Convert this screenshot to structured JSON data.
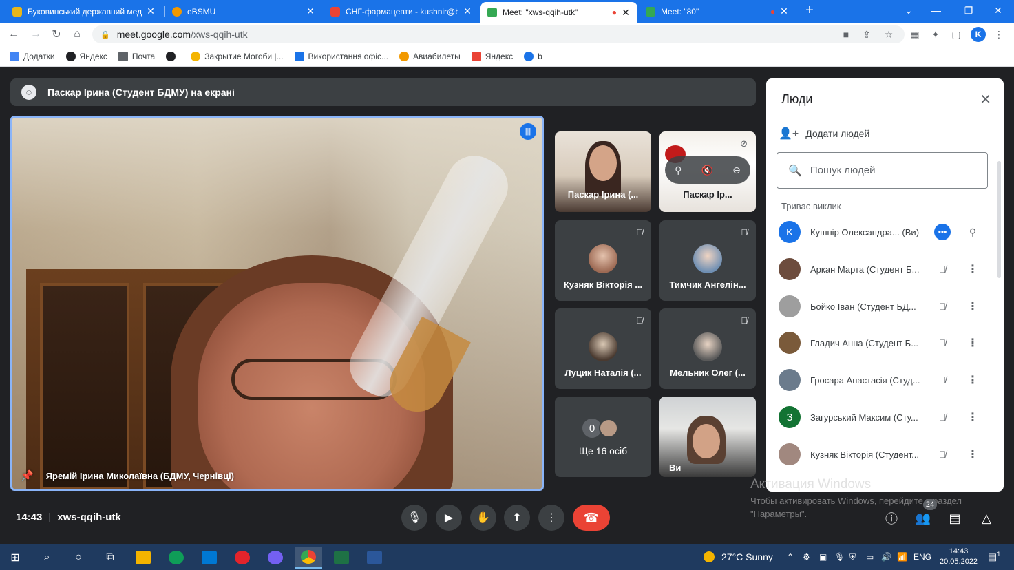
{
  "tabs": [
    {
      "title": "Буковинський державний меди",
      "favicon_color": "#e8b71a"
    },
    {
      "title": "eBSMU",
      "favicon_color": "#f29900"
    },
    {
      "title": "СНГ-фармацевти - kushnir@bsm",
      "favicon_color": "#ea4335"
    },
    {
      "title": "Meet: \"xws-qqih-utk\"",
      "favicon_color": "#34a853"
    },
    {
      "title": "Meet: \"80\"",
      "favicon_color": "#34a853"
    }
  ],
  "browser": {
    "url_host": "meet.google.com",
    "url_path": "/xws-qqih-utk",
    "profile_initial": "K"
  },
  "bookmarks": [
    {
      "label": "Додатки",
      "color": "#4285f4"
    },
    {
      "label": "Яндекс",
      "color": "#202124"
    },
    {
      "label": "Почта",
      "color": "#5f6368"
    },
    {
      "label": "",
      "color": "#202124"
    },
    {
      "label": "Закрытие Могоби |...",
      "color": "#f4b400"
    },
    {
      "label": "Використання офіс...",
      "color": "#1a73e8"
    },
    {
      "label": "Авиабилеты",
      "color": "#f29900"
    },
    {
      "label": "Яндекс",
      "color": "#ea4335"
    },
    {
      "label": "b",
      "color": "#1a73e8"
    }
  ],
  "meet": {
    "presenting_text": "Паскар Ірина (Студент БДМУ) на екрані",
    "main_speaker": "Яремій Ірина Миколаївна (БДМУ, Чернівці)",
    "tiles": [
      {
        "name": "Паскар Ірина (..."
      },
      {
        "name": "Паскар Ір..."
      },
      {
        "name": "Кузняк Вікторія ..."
      },
      {
        "name": "Тимчик Ангелін..."
      },
      {
        "name": "Луцик Наталія (..."
      },
      {
        "name": "Мельник Олег (..."
      },
      {
        "name": "Ще 16 осіб",
        "counter": "0"
      },
      {
        "name": "Ви"
      }
    ],
    "meeting_time": "14:43",
    "meeting_code": "xws-qqih-utk",
    "participant_badge": "24"
  },
  "people_panel": {
    "title": "Люди",
    "add_people": "Додати людей",
    "search_placeholder": "Пошук людей",
    "section": "Триває виклик",
    "participants": [
      {
        "name": "Кушнір Олександра... (Ви)",
        "initial": "K",
        "color": "#1a73e8"
      },
      {
        "name": "Аркан Марта (Студент Б...",
        "initial": "",
        "color": "#6d4c3d"
      },
      {
        "name": "Бойко Іван (Студент БД...",
        "initial": "",
        "color": "#9e9e9e"
      },
      {
        "name": "Гладич Анна (Студент Б...",
        "initial": "",
        "color": "#7a5a3a"
      },
      {
        "name": "Гросара Анастасія (Студ...",
        "initial": "",
        "color": "#6b7b8c"
      },
      {
        "name": "Загурський Максим (Сту...",
        "initial": "З",
        "color": "#137333"
      },
      {
        "name": "Кузняк Вікторія (Студент...",
        "initial": "",
        "color": "#a1887f"
      }
    ]
  },
  "windows_watermark": {
    "title": "Активация Windows",
    "text": "Чтобы активировать Windows, перейдите в раздел \"Параметры\"."
  },
  "taskbar": {
    "weather": "27°C  Sunny",
    "lang": "ENG",
    "time": "14:43",
    "date": "20.05.2022",
    "notifications": "1"
  }
}
